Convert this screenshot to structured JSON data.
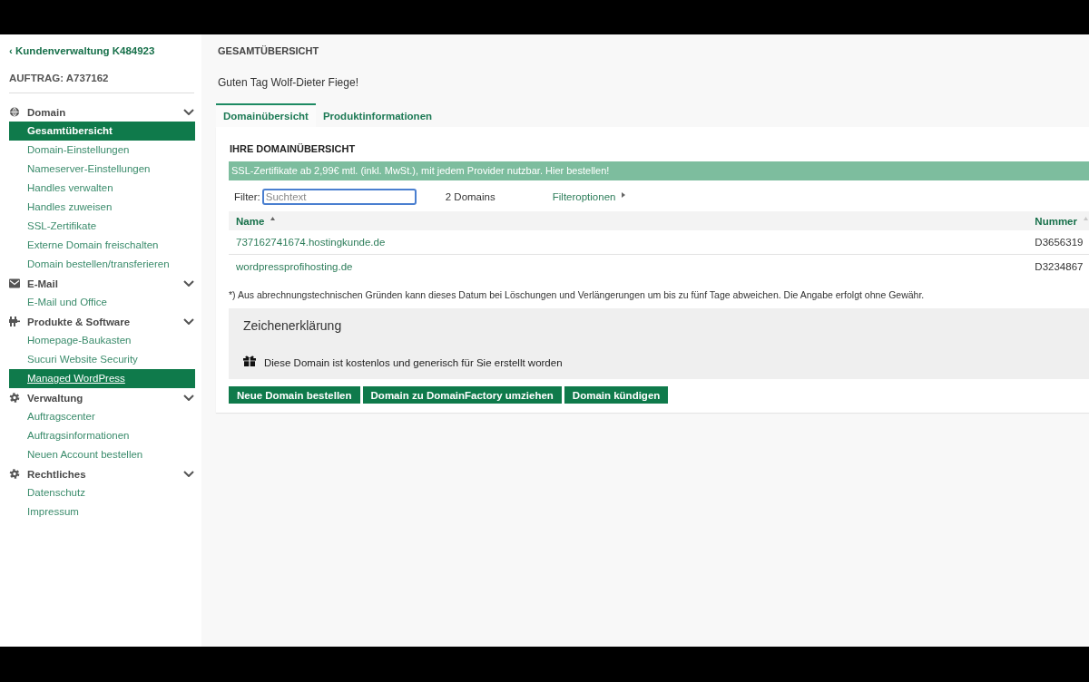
{
  "sidebar": {
    "back_link": "‹ Kundenverwaltung K484923",
    "order": "AUFTRAG: A737162",
    "groups": [
      {
        "label": "Domain",
        "expanded": true,
        "items": [
          {
            "label": "Gesamtübersicht",
            "selected": true,
            "hovered": false
          },
          {
            "label": "Domain-Einstellungen",
            "selected": false,
            "hovered": false
          },
          {
            "label": "Nameserver-Einstellungen",
            "selected": false,
            "hovered": false
          },
          {
            "label": "Handles verwalten",
            "selected": false,
            "hovered": false
          },
          {
            "label": "Handles zuweisen",
            "selected": false,
            "hovered": false
          },
          {
            "label": "SSL-Zertifikate",
            "selected": false,
            "hovered": false
          },
          {
            "label": "Externe Domain freischalten",
            "selected": false,
            "hovered": false
          },
          {
            "label": "Domain bestellen/transferieren",
            "selected": false,
            "hovered": false
          }
        ]
      },
      {
        "label": "E-Mail",
        "expanded": true,
        "items": [
          {
            "label": "E-Mail und Office",
            "selected": false,
            "hovered": false
          }
        ]
      },
      {
        "label": "Produkte & Software",
        "expanded": true,
        "items": [
          {
            "label": "Homepage-Baukasten",
            "selected": false,
            "hovered": false
          },
          {
            "label": "Sucuri Website Security",
            "selected": false,
            "hovered": false
          },
          {
            "label": "Managed WordPress",
            "selected": false,
            "hovered": true
          }
        ]
      },
      {
        "label": "Verwaltung",
        "expanded": true,
        "items": [
          {
            "label": "Auftragscenter",
            "selected": false,
            "hovered": false
          },
          {
            "label": "Auftragsinformationen",
            "selected": false,
            "hovered": false
          },
          {
            "label": "Neuen Account bestellen",
            "selected": false,
            "hovered": false
          }
        ]
      },
      {
        "label": "Rechtliches",
        "expanded": true,
        "items": [
          {
            "label": "Datenschutz",
            "selected": false,
            "hovered": false
          },
          {
            "label": "Impressum",
            "selected": false,
            "hovered": false
          }
        ]
      }
    ]
  },
  "page_title": "GESAMTÜBERSICHT",
  "greeting": "Guten Tag Wolf-Dieter Fiege!",
  "tabs": [
    {
      "label": "Domainübersicht",
      "selected": true
    },
    {
      "label": "Produktinformationen",
      "selected": false
    }
  ],
  "panel": {
    "title": "IHRE DOMAINÜBERSICHT",
    "banner": "SSL-Zertifikate ab 2,99€ mtl. (inkl. MwSt.), mit jedem Provider nutzbar. Hier bestellen!",
    "filter": {
      "label": "Filter:",
      "placeholder": "Suchtext",
      "focused": true
    },
    "count": "2 Domains",
    "filter_options": "Filteroptionen",
    "table": {
      "columns": [
        {
          "label": "Name",
          "sorted": true
        },
        {
          "label": "Nummer",
          "sorted": false
        }
      ],
      "rows": [
        [
          "737162741674.hostingkunde.de",
          "D3656319"
        ],
        [
          "wordpressprofihosting.de",
          "D3234867"
        ]
      ]
    },
    "footnote": "*) Aus abrechnungstechnischen Gründen kann dieses Datum bei Löschungen und Verlängerungen um bis zu fünf Tage abweichen. Die Angabe erfolgt ohne Gewähr.",
    "legend": {
      "title": "Zeichenerklärung",
      "items": [
        "Diese Domain ist kostenlos und generisch für Sie erstellt worden"
      ]
    },
    "buttons": [
      "Neue Domain bestellen",
      "Domain zu DomainFactory umziehen",
      "Domain kündigen"
    ]
  }
}
